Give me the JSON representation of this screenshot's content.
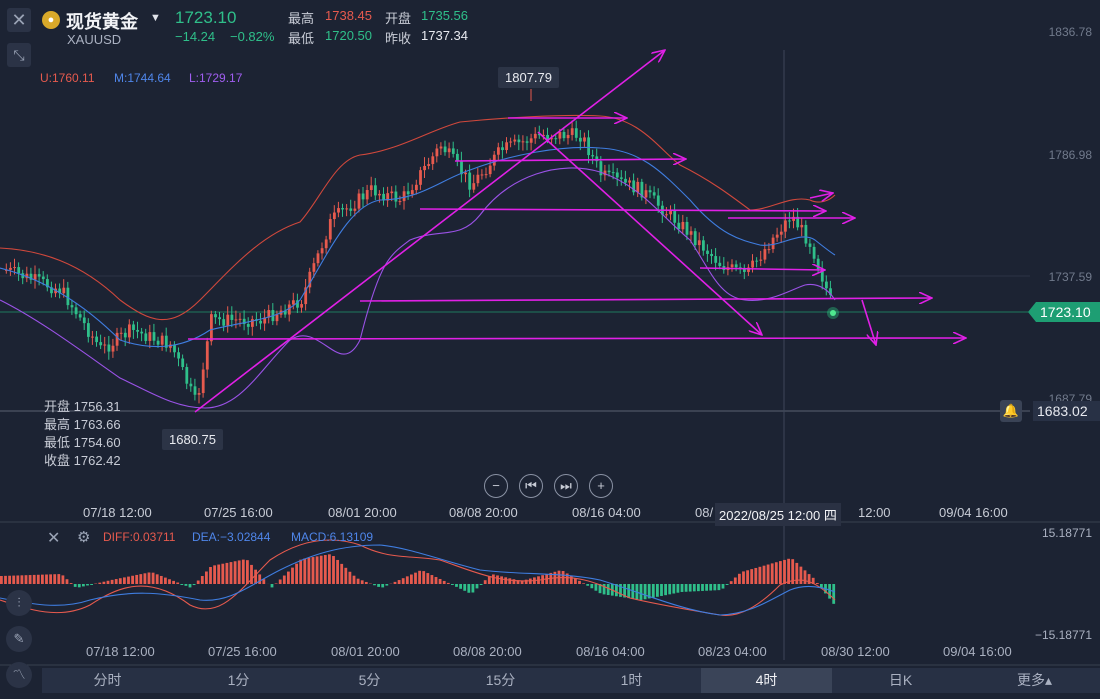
{
  "header": {
    "title": "现货黄金",
    "symbol": "XAUUSD",
    "price": "1723.10",
    "change": "−14.24",
    "change_pct": "−0.82%",
    "high_label": "最高",
    "high": "1738.45",
    "open_label": "开盘",
    "open": "1735.56",
    "low_label": "最低",
    "low": "1720.50",
    "prev_close_label": "昨收",
    "prev_close": "1737.34"
  },
  "indicators": {
    "upper": "U:1760.11",
    "middle": "M:1744.64",
    "lower": "L:1729.17"
  },
  "annotations": {
    "peak": "1807.79",
    "trough": "1680.75"
  },
  "ohlc_panel": [
    {
      "label": "开盘",
      "value": "1756.31"
    },
    {
      "label": "最高",
      "value": "1763.66"
    },
    {
      "label": "最低",
      "value": "1754.60"
    },
    {
      "label": "收盘",
      "value": "1762.42"
    }
  ],
  "price_axis": [
    "1836.78",
    "1786.98",
    "1737.59",
    "1687.79"
  ],
  "current_price_flag": "1723.10",
  "alert_price_flag": "1683.02",
  "time_axis": [
    "07/18 12:00",
    "07/25 16:00",
    "08/01 20:00",
    "08/08 20:00",
    "08/16 04:00",
    "08/",
    "12:00",
    "09/04 16:00"
  ],
  "crosshair_date": "2022/08/25 12:00 四",
  "macd": {
    "diff": "DIFF:0.03711",
    "dea": "DEA:−3.02844",
    "macd": "MACD:6.13109",
    "axis_top": "15.18771",
    "axis_bottom": "−15.18771",
    "time_axis": [
      "07/18 12:00",
      "07/25 16:00",
      "08/01 20:00",
      "08/08 20:00",
      "08/16 04:00",
      "08/23 04:00",
      "08/30 12:00",
      "09/04 16:00"
    ]
  },
  "timeframes": [
    "分时",
    "1分",
    "5分",
    "15分",
    "1时",
    "4时",
    "日K",
    "更多▴"
  ],
  "active_timeframe": "4时",
  "colors": {
    "up": "#e65a4e",
    "down": "#2fbf8a",
    "trendline": "#e020e6",
    "upper_band": "#d0483c",
    "middle_band": "#3f7de0",
    "lower_band": "#9a52e6"
  },
  "icons": {
    "close": "close-icon",
    "expand": "expand-icon",
    "zoom_out": "minus-circle-icon",
    "prev": "skip-back-icon",
    "next": "skip-forward-icon",
    "zoom_in": "plus-circle-icon",
    "bell": "bell-icon",
    "settings": "gear-icon"
  }
}
